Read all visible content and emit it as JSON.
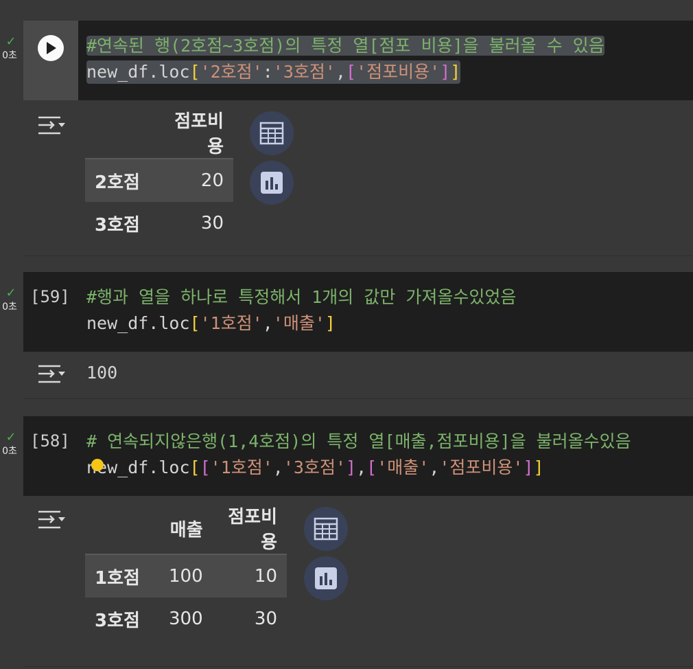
{
  "cells": [
    {
      "status": "0초",
      "comment": "#연속된 행(2호점~3호점)의 특정 열[점포 비용]을 불러올 수 있음",
      "code": {
        "prefix": "new_df.loc",
        "open1": "[",
        "s1": "'2호점'",
        "colon": ":",
        "s2": "'3호점'",
        "comma": ",",
        "open2": "[",
        "s3": "'점포비용'",
        "close2": "]",
        "close1": "]"
      },
      "table": {
        "columns": [
          "점포비용"
        ],
        "rows": [
          {
            "index": "2호점",
            "values": [
              "20"
            ]
          },
          {
            "index": "3호점",
            "values": [
              "30"
            ]
          }
        ]
      }
    },
    {
      "status": "0초",
      "exec_count": "[59]",
      "comment": "#행과 열을 하나로 특정해서 1개의 값만 가져올수있었음",
      "code": {
        "prefix": "new_df.loc",
        "open1": "[",
        "s1": "'1호점'",
        "comma": ",",
        "s2": "'매출'",
        "close1": "]"
      },
      "output": "100"
    },
    {
      "status": "0초",
      "exec_count": "[58]",
      "comment": "# 연속되지않은행(1,4호점)의 특정 열[매출,점포비용]을 불러올수있음",
      "code": {
        "prefix": "new_df.loc",
        "open1": "[",
        "open2": "[",
        "s1": "'1호점'",
        "comma1": ",",
        "s2": "'3호점'",
        "close2": "]",
        "comma2": ",",
        "open3": "[",
        "s3": "'매출'",
        "comma3": ",",
        "s4": "'점포비용'",
        "close3": "]",
        "close1": "]"
      },
      "table": {
        "columns": [
          "매출",
          "점포비용"
        ],
        "rows": [
          {
            "index": "1호점",
            "values": [
              "100",
              "10"
            ]
          },
          {
            "index": "3호점",
            "values": [
              "300",
              "30"
            ]
          }
        ]
      }
    }
  ],
  "icons": {
    "run": "play-icon",
    "output": "output-toggle-icon",
    "table": "table-icon",
    "chart": "bar-chart-icon",
    "check": "checkmark-icon"
  },
  "colors": {
    "comment": "#7cb36a",
    "string": "#ce9178",
    "bracket1": "#f7d23b",
    "bracket2": "#d46fcf",
    "success": "#4caf50"
  }
}
